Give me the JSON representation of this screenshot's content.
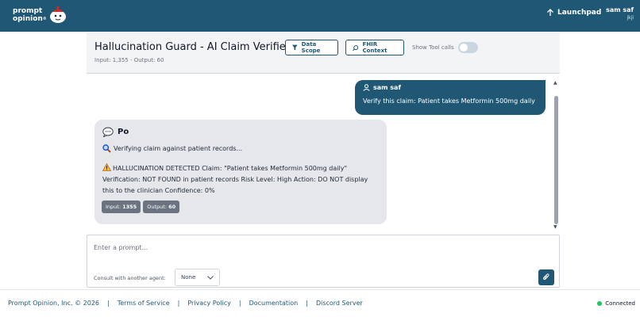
{
  "brand": {
    "line1": "prompt",
    "line2": "opinion",
    "trademark": "®"
  },
  "topbar": {
    "launchpad_label": "Launchpad",
    "user_name": "sam saf",
    "user_sub": "jkji"
  },
  "header": {
    "title": "Hallucination Guard - AI Claim Verifier",
    "usage": "Input: 1,355 - Output: 60",
    "data_scope_label": "Data Scope",
    "fhir_context_label": "FHIR Context",
    "show_tool_calls_label": "Show Tool calls",
    "show_tool_calls_on": false
  },
  "chat": {
    "user_message": {
      "author": "sam saf",
      "text": "Verify this claim: Patient takes Metformin 500mg daily"
    },
    "bot_message": {
      "author": "Po",
      "line1": "Verifying claim against patient records...",
      "paragraph": "HALLUCINATION DETECTED Claim: \"Patient takes Metformin 500mg daily\" Verification: NOT FOUND in patient records Risk Level: High Action: DO NOT display this to the clinician Confidence: 0%",
      "tokens": {
        "input_label": "Input:",
        "input_value": "1355",
        "output_label": "Output:",
        "output_value": "60"
      }
    }
  },
  "prompt": {
    "placeholder": "Enter a prompt...",
    "consult_label": "Consult with another agent:",
    "consult_selected": "None"
  },
  "footer": {
    "copyright": "Prompt Opinion, Inc. © 2026",
    "links": [
      "Terms of Service",
      "Privacy Policy",
      "Documentation",
      "Discord Server"
    ],
    "status": "Connected"
  },
  "colors": {
    "brand": "#1f5775",
    "status_ok": "#22c55e"
  }
}
